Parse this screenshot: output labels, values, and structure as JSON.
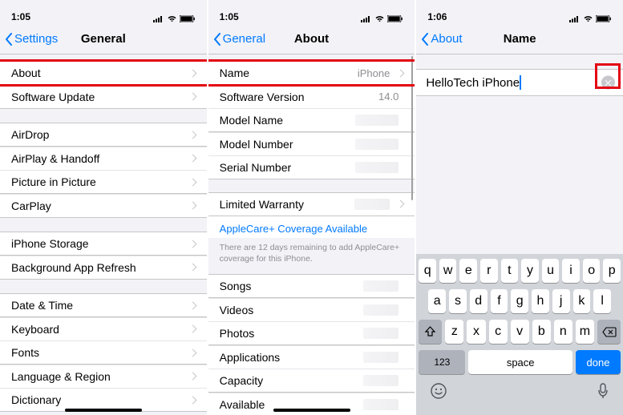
{
  "screens": {
    "general": {
      "status_time": "1:05",
      "back_label": "Settings",
      "title": "General",
      "items": [
        "About",
        "Software Update",
        "AirDrop",
        "AirPlay & Handoff",
        "Picture in Picture",
        "CarPlay",
        "iPhone Storage",
        "Background App Refresh",
        "Date & Time",
        "Keyboard",
        "Fonts",
        "Language & Region",
        "Dictionary"
      ]
    },
    "about": {
      "status_time": "1:05",
      "back_label": "General",
      "title": "About",
      "name_label": "Name",
      "name_value": "iPhone",
      "rows_top": [
        "Software Version",
        "Model Name",
        "Model Number",
        "Serial Number"
      ],
      "software_version_value": "14.0",
      "warranty_label": "Limited Warranty",
      "applecare_link": "AppleCare+ Coverage Available",
      "applecare_note": "There are 12 days remaining to add AppleCare+ coverage for this iPhone.",
      "rows_bottom": [
        "Songs",
        "Videos",
        "Photos",
        "Applications",
        "Capacity",
        "Available"
      ]
    },
    "name": {
      "status_time": "1:06",
      "back_label": "About",
      "title": "Name",
      "input_value": "HelloTech iPhone"
    }
  },
  "keyboard": {
    "row1": [
      "q",
      "w",
      "e",
      "r",
      "t",
      "y",
      "u",
      "i",
      "o",
      "p"
    ],
    "row2": [
      "a",
      "s",
      "d",
      "f",
      "g",
      "h",
      "j",
      "k",
      "l"
    ],
    "row3": [
      "z",
      "x",
      "c",
      "v",
      "b",
      "n",
      "m"
    ],
    "mode_key": "123",
    "space_key": "space",
    "done_key": "done"
  }
}
